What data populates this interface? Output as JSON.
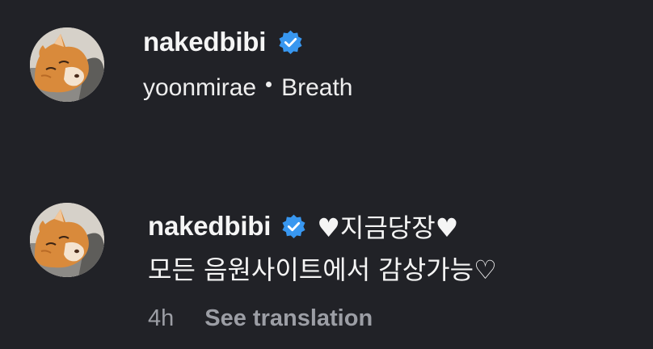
{
  "post": {
    "username": "nakedbibi",
    "verified": true,
    "music_artist": "yoonmirae",
    "music_separator": "•",
    "music_title": "Breath"
  },
  "comment": {
    "username": "nakedbibi",
    "verified": true,
    "text_line1": "♥지금당장♥",
    "text_line2": "모든 음원사이트에서 감상가능♡",
    "time": "4h",
    "see_translation": "See translation"
  },
  "icons": {
    "verified": "verified-badge-icon",
    "avatar": "cat-avatar"
  },
  "colors": {
    "background": "#212227",
    "verified": "#3897f0",
    "muted": "#9c9ea5"
  }
}
